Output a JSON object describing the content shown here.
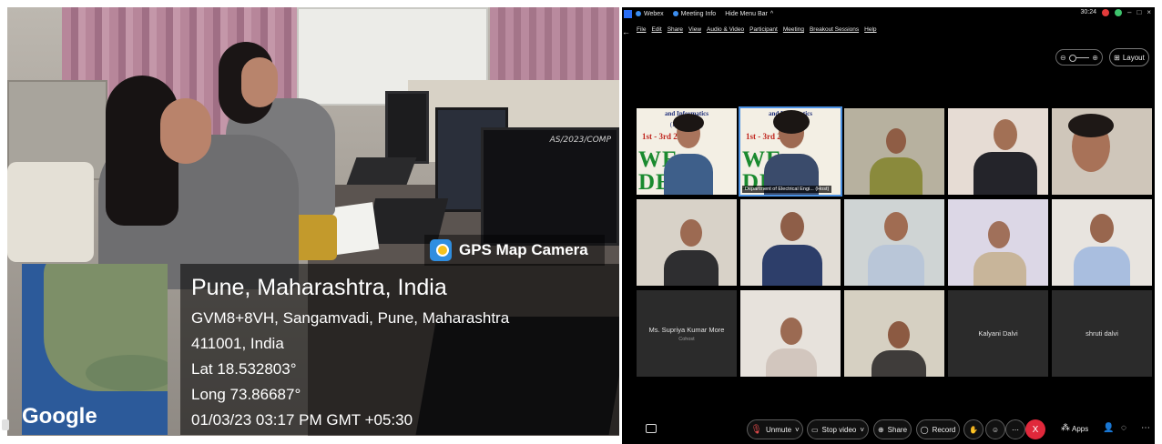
{
  "photo": {
    "monitor_label": "AS/2023/COMP",
    "gps_brand": "GPS Map Camera",
    "map_label": "Google",
    "city": "Pune, Maharashtra, India",
    "address_line1": "GVM8+8VH, Sangamvadi, Pune, Maharashtra",
    "address_line2": "411001, India",
    "lat": "Lat 18.532803°",
    "long": "Long 73.86687°",
    "datetime": "01/03/23 03:17 PM GMT +05:30",
    "colors": {
      "overlay": "#000000",
      "map_water": "#2c5a9a",
      "logo": "#2f8ee0"
    }
  },
  "webex": {
    "titlebar": {
      "app_name": "Webex",
      "meeting_info": "Meeting Info",
      "hide_menu": "Hide Menu Bar",
      "timer": "30:24"
    },
    "menu": [
      "File",
      "Edit",
      "Share",
      "View",
      "Audio & Video",
      "Participant",
      "Meeting",
      "Breakout Sessions",
      "Help"
    ],
    "layout_label": "Layout",
    "banner": {
      "line1": "and Informatics",
      "line2": "(IEEE-2023)",
      "dates": "1st - 3rd 2023",
      "welcome_left": "WE\nDE",
      "welcome_mid": "WE  ME\nDE  ES"
    },
    "tiles": [
      {
        "name": "",
        "type": "video-banner"
      },
      {
        "name": "Department of Electrical Engi... (Host)",
        "type": "video-banner",
        "active": true
      },
      {
        "name": "",
        "type": "video"
      },
      {
        "name": "",
        "type": "video"
      },
      {
        "name": "",
        "type": "video"
      },
      {
        "name": "",
        "type": "video"
      },
      {
        "name": "",
        "type": "video"
      },
      {
        "name": "",
        "type": "video"
      },
      {
        "name": "",
        "type": "video"
      },
      {
        "name": "",
        "type": "video"
      },
      {
        "name": "Ms. Supriya Kumar More",
        "sub": "Cohost",
        "type": "empty"
      },
      {
        "name": "",
        "type": "video"
      },
      {
        "name": "",
        "type": "video"
      },
      {
        "name": "Kalyani Dalvi",
        "type": "empty"
      },
      {
        "name": "shruti dalvi",
        "type": "empty"
      }
    ],
    "controls": {
      "unmute": "Unmute",
      "stop_video": "Stop video",
      "share": "Share",
      "record": "Record",
      "apps": "Apps",
      "end": "X"
    },
    "colors": {
      "end_button": "#e0283b",
      "active_border": "#4a90e2",
      "accent": "#2b6ff6"
    }
  }
}
